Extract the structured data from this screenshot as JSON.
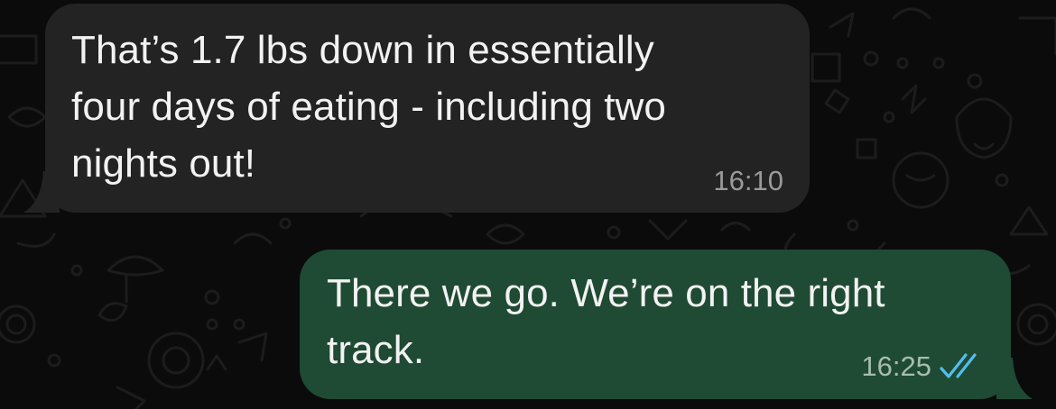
{
  "chat": {
    "messages": [
      {
        "direction": "incoming",
        "text": "That’s 1.7 lbs down in essentially\nfour days of eating - including two\nnights out!",
        "time": "16:10"
      },
      {
        "direction": "outgoing",
        "text": "There we go. We’re on the right\ntrack.",
        "time": "16:25",
        "status_icon": "double-check-read-icon"
      }
    ]
  },
  "colors": {
    "background": "#0b0b0b",
    "incoming_bubble": "#232323",
    "outgoing_bubble": "#1f4a33",
    "read_ticks": "#53bdeb"
  }
}
